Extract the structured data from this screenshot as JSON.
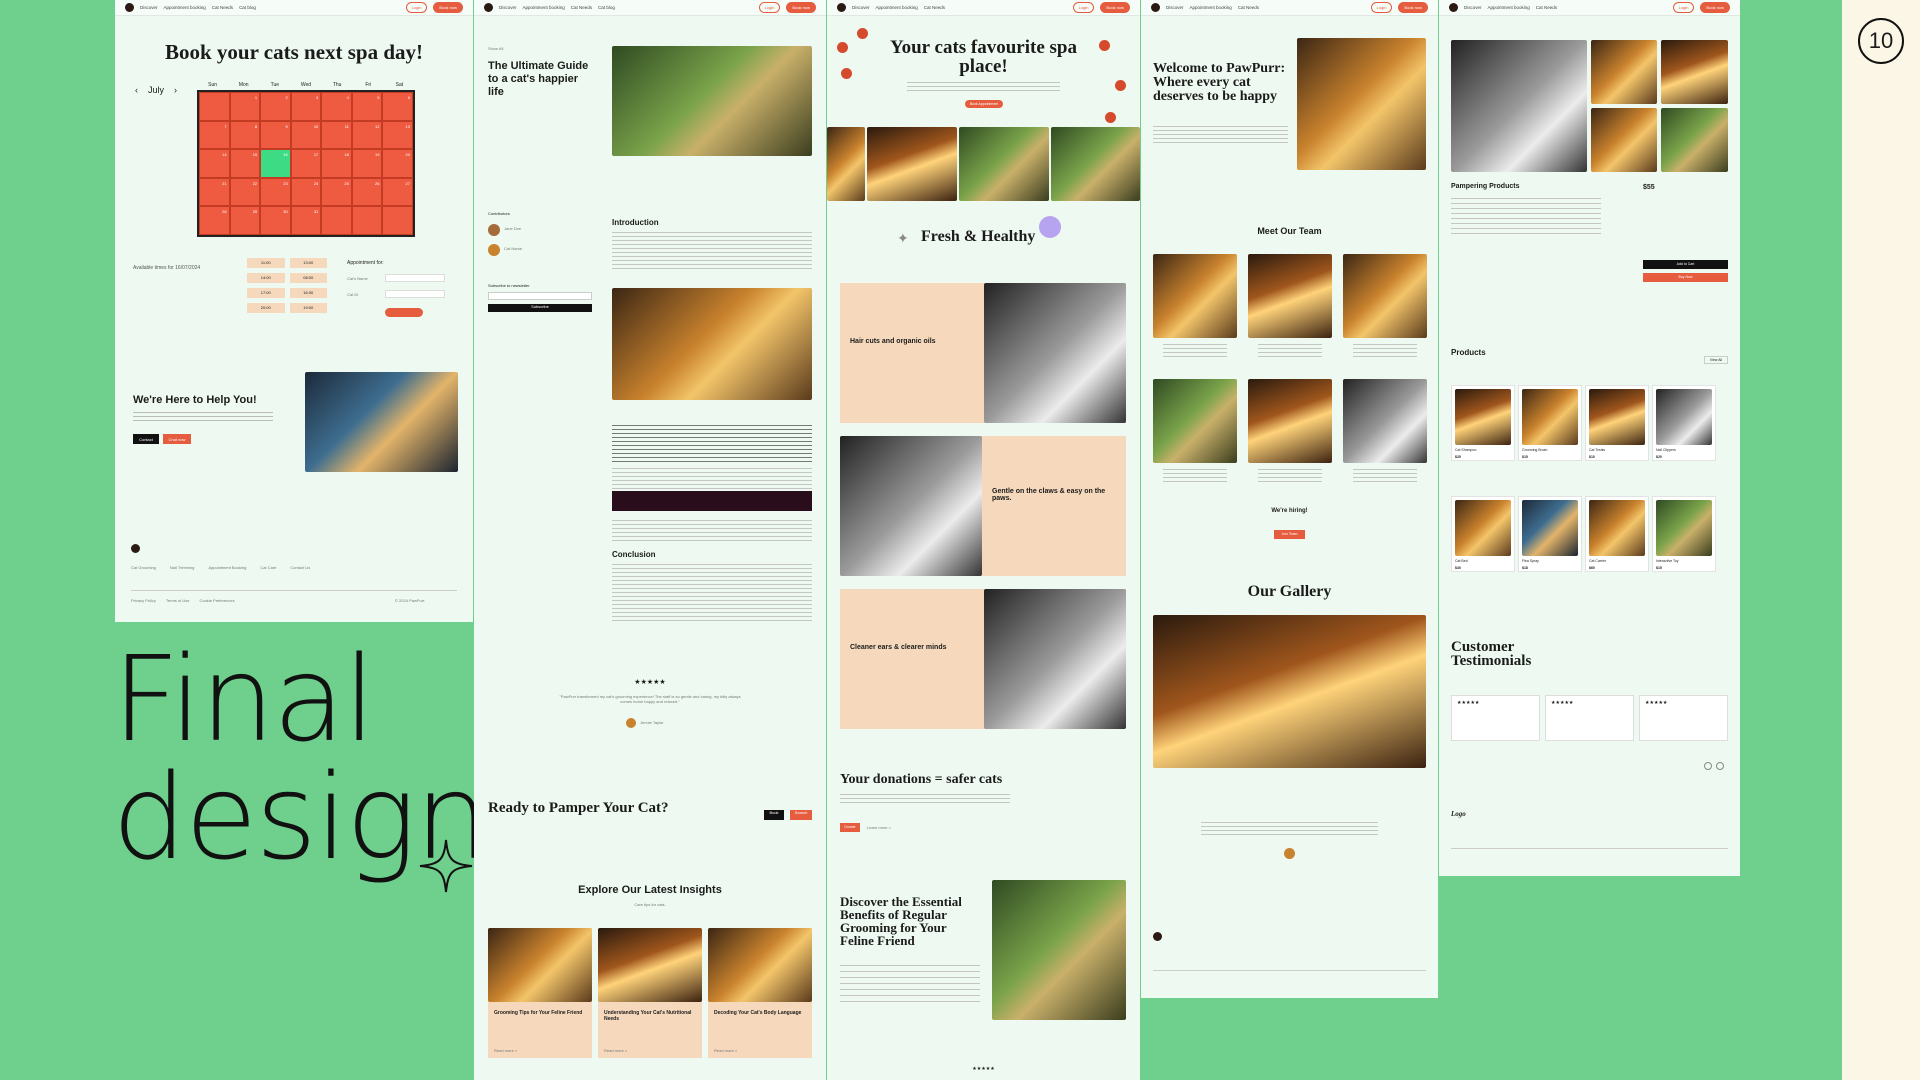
{
  "page_number": "10",
  "headline": {
    "line1": "Final",
    "line2": "design"
  },
  "nav": {
    "links": [
      "Discover",
      "Appointment booking",
      "Cat Needs",
      "Cat blog"
    ],
    "login": "Login",
    "cta": "Book now"
  },
  "booking": {
    "title": "Book your cats next spa day!",
    "month": "July",
    "weekdays": [
      "Sun",
      "Mon",
      "Tue",
      "Wed",
      "Thu",
      "Fri",
      "Sat"
    ],
    "days": [
      "",
      "1",
      "2",
      "3",
      "4",
      "5",
      "6",
      "7",
      "8",
      "9",
      "10",
      "11",
      "12",
      "13",
      "14",
      "15",
      "16",
      "17",
      "18",
      "19",
      "20",
      "21",
      "22",
      "23",
      "24",
      "25",
      "26",
      "27",
      "28",
      "29",
      "30",
      "31",
      "",
      "",
      ""
    ],
    "available": "Available times for 16/07/2024",
    "times": [
      "11:00",
      "13:00",
      "14:00",
      "08:00",
      "17:00",
      "16:30",
      "20:00",
      "19:00"
    ],
    "appt_label": "Appointment for:",
    "cat_name": "Cat's Name",
    "cat_id": "Cat ID",
    "help_title": "We're Here to Help You!",
    "help_btn1": "Contact",
    "help_btn2": "Chat now",
    "footer_links": [
      "Cat Grooming",
      "Nail Trimming",
      "Appointment Booking",
      "Cat Care",
      "Contact Us"
    ],
    "footer_legal": [
      "Privacy Policy",
      "Terms of Use",
      "Cookie Preferences"
    ],
    "copyright": "© 2024 PawPurr."
  },
  "blog": {
    "back": "Show All",
    "title": "The Ultimate Guide to a cat's happier life",
    "contributors": "Contributors",
    "author1": "Jane Doe",
    "author2": "Cat Name",
    "subscribe": "Subscribe to newsletter",
    "subscribe_btn": "Subscribe",
    "intro": "Introduction",
    "conclusion": "Conclusion",
    "stars": "★★★★★",
    "quote": "\"PawPurr transformed my cat's grooming experience! The staff is so gentle and caring, my kitty always comes home happy and relaxed.\"",
    "quote_author": "Jennie Taylor",
    "ready": "Ready to Pamper Your Cat?",
    "ready_btn1": "Book",
    "ready_btn2": "Search",
    "insights": "Explore Our Latest Insights",
    "insights_sub": "Care tips for cats.",
    "cards": [
      "Grooming Tips for Your Feline Friend",
      "Understanding Your Cat's Nutritional Needs",
      "Decoding Your Cat's Body Language"
    ],
    "read_more": "Read more  >"
  },
  "landing": {
    "title": "Your cats favourite spa place!",
    "cta": "Book Appointment",
    "fresh": "Fresh & Healthy",
    "features": [
      "Hair cuts and organic oils",
      "Gentle on the claws & easy on the paws.",
      "Cleaner ears & clearer minds"
    ],
    "donations": "Your donations = safer cats",
    "donate_btn": "Donate",
    "learn": "Learn more  >",
    "discover": "Discover the Essential Benefits of Regular Grooming for Your Feline Friend",
    "stars": "★★★★★"
  },
  "about": {
    "welcome": "Welcome to PawPurr: Where every cat deserves to be happy",
    "team_title": "Meet Our Team",
    "hiring": "We're hiring!",
    "hiring_btn": "Join Team",
    "gallery": "Our Gallery"
  },
  "shop": {
    "product": "Pampering Products",
    "price": "$55",
    "add": "Add to Cart",
    "buy": "Buy Now",
    "products_title": "Products",
    "view_all": "View All",
    "items": [
      {
        "name": "Cat Shampoo",
        "price": "$25"
      },
      {
        "name": "Grooming Brush",
        "price": "$15"
      },
      {
        "name": "Cat Treats",
        "price": "$10"
      },
      {
        "name": "Nail Clippers",
        "price": "$20"
      },
      {
        "name": "Cat Bed",
        "price": "$40"
      },
      {
        "name": "Flea Spray",
        "price": "$18"
      },
      {
        "name": "Cat Carrier",
        "price": "$60"
      },
      {
        "name": "Interactive Toy",
        "price": "$15"
      }
    ],
    "testimonials": "Customer Testimonials",
    "stars": "★★★★★",
    "logo": "Logo"
  }
}
